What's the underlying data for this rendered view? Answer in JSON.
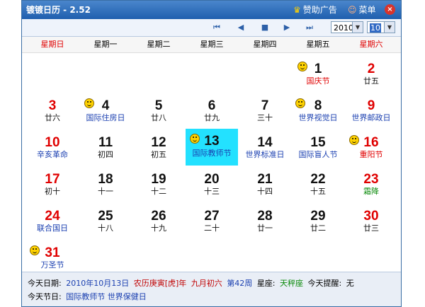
{
  "window": {
    "title": "镀镀日历 - 2.52",
    "sponsor_label": "赞助广告",
    "menu_label": "菜单",
    "close_glyph": "×"
  },
  "toolbar": {
    "year": "2010",
    "month": "10"
  },
  "weekdays": [
    "星期日",
    "星期一",
    "星期二",
    "星期三",
    "星期四",
    "星期五",
    "星期六"
  ],
  "days": [
    {
      "day": "1",
      "sub": "国庆节"
    },
    {
      "day": "2",
      "sub": "廿五"
    },
    {
      "day": "3",
      "sub": "廿六"
    },
    {
      "day": "4",
      "sub": "国际住房日"
    },
    {
      "day": "5",
      "sub": "廿八"
    },
    {
      "day": "6",
      "sub": "廿九"
    },
    {
      "day": "7",
      "sub": "三十"
    },
    {
      "day": "8",
      "sub": "世界视觉日"
    },
    {
      "day": "9",
      "sub": "世界邮政日"
    },
    {
      "day": "10",
      "sub": "辛亥革命"
    },
    {
      "day": "11",
      "sub": "初四"
    },
    {
      "day": "12",
      "sub": "初五"
    },
    {
      "day": "13",
      "sub": "国际教师节"
    },
    {
      "day": "14",
      "sub": "世界标准日"
    },
    {
      "day": "15",
      "sub": "国际盲人节"
    },
    {
      "day": "16",
      "sub": "重阳节"
    },
    {
      "day": "17",
      "sub": "初十"
    },
    {
      "day": "18",
      "sub": "十一"
    },
    {
      "day": "19",
      "sub": "十二"
    },
    {
      "day": "20",
      "sub": "十三"
    },
    {
      "day": "21",
      "sub": "十四"
    },
    {
      "day": "22",
      "sub": "十五"
    },
    {
      "day": "23",
      "sub": "霜降"
    },
    {
      "day": "24",
      "sub": "联合国日"
    },
    {
      "day": "25",
      "sub": "十八"
    },
    {
      "day": "26",
      "sub": "十九"
    },
    {
      "day": "27",
      "sub": "二十"
    },
    {
      "day": "28",
      "sub": "廿一"
    },
    {
      "day": "29",
      "sub": "廿二"
    },
    {
      "day": "30",
      "sub": "廿三"
    },
    {
      "day": "31",
      "sub": "万圣节"
    }
  ],
  "footer": {
    "today_label": "今天日期:",
    "today_date": "2010年10月13日",
    "lunar": "农历庚寅[虎]年",
    "lunar_day": "九月初六",
    "week": "第42周",
    "zodiac_label": "星座:",
    "zodiac": "天秤座",
    "reminder_label": "今天提醒:",
    "reminder": "无",
    "festival_label": "今天节日:",
    "festivals": "国际教师节 世界保健日"
  },
  "colors": {
    "titlebar": "#1f5fae",
    "today_highlight": "#23e1ff",
    "weekend": "#e00000",
    "festival": "#1a3fb0"
  }
}
